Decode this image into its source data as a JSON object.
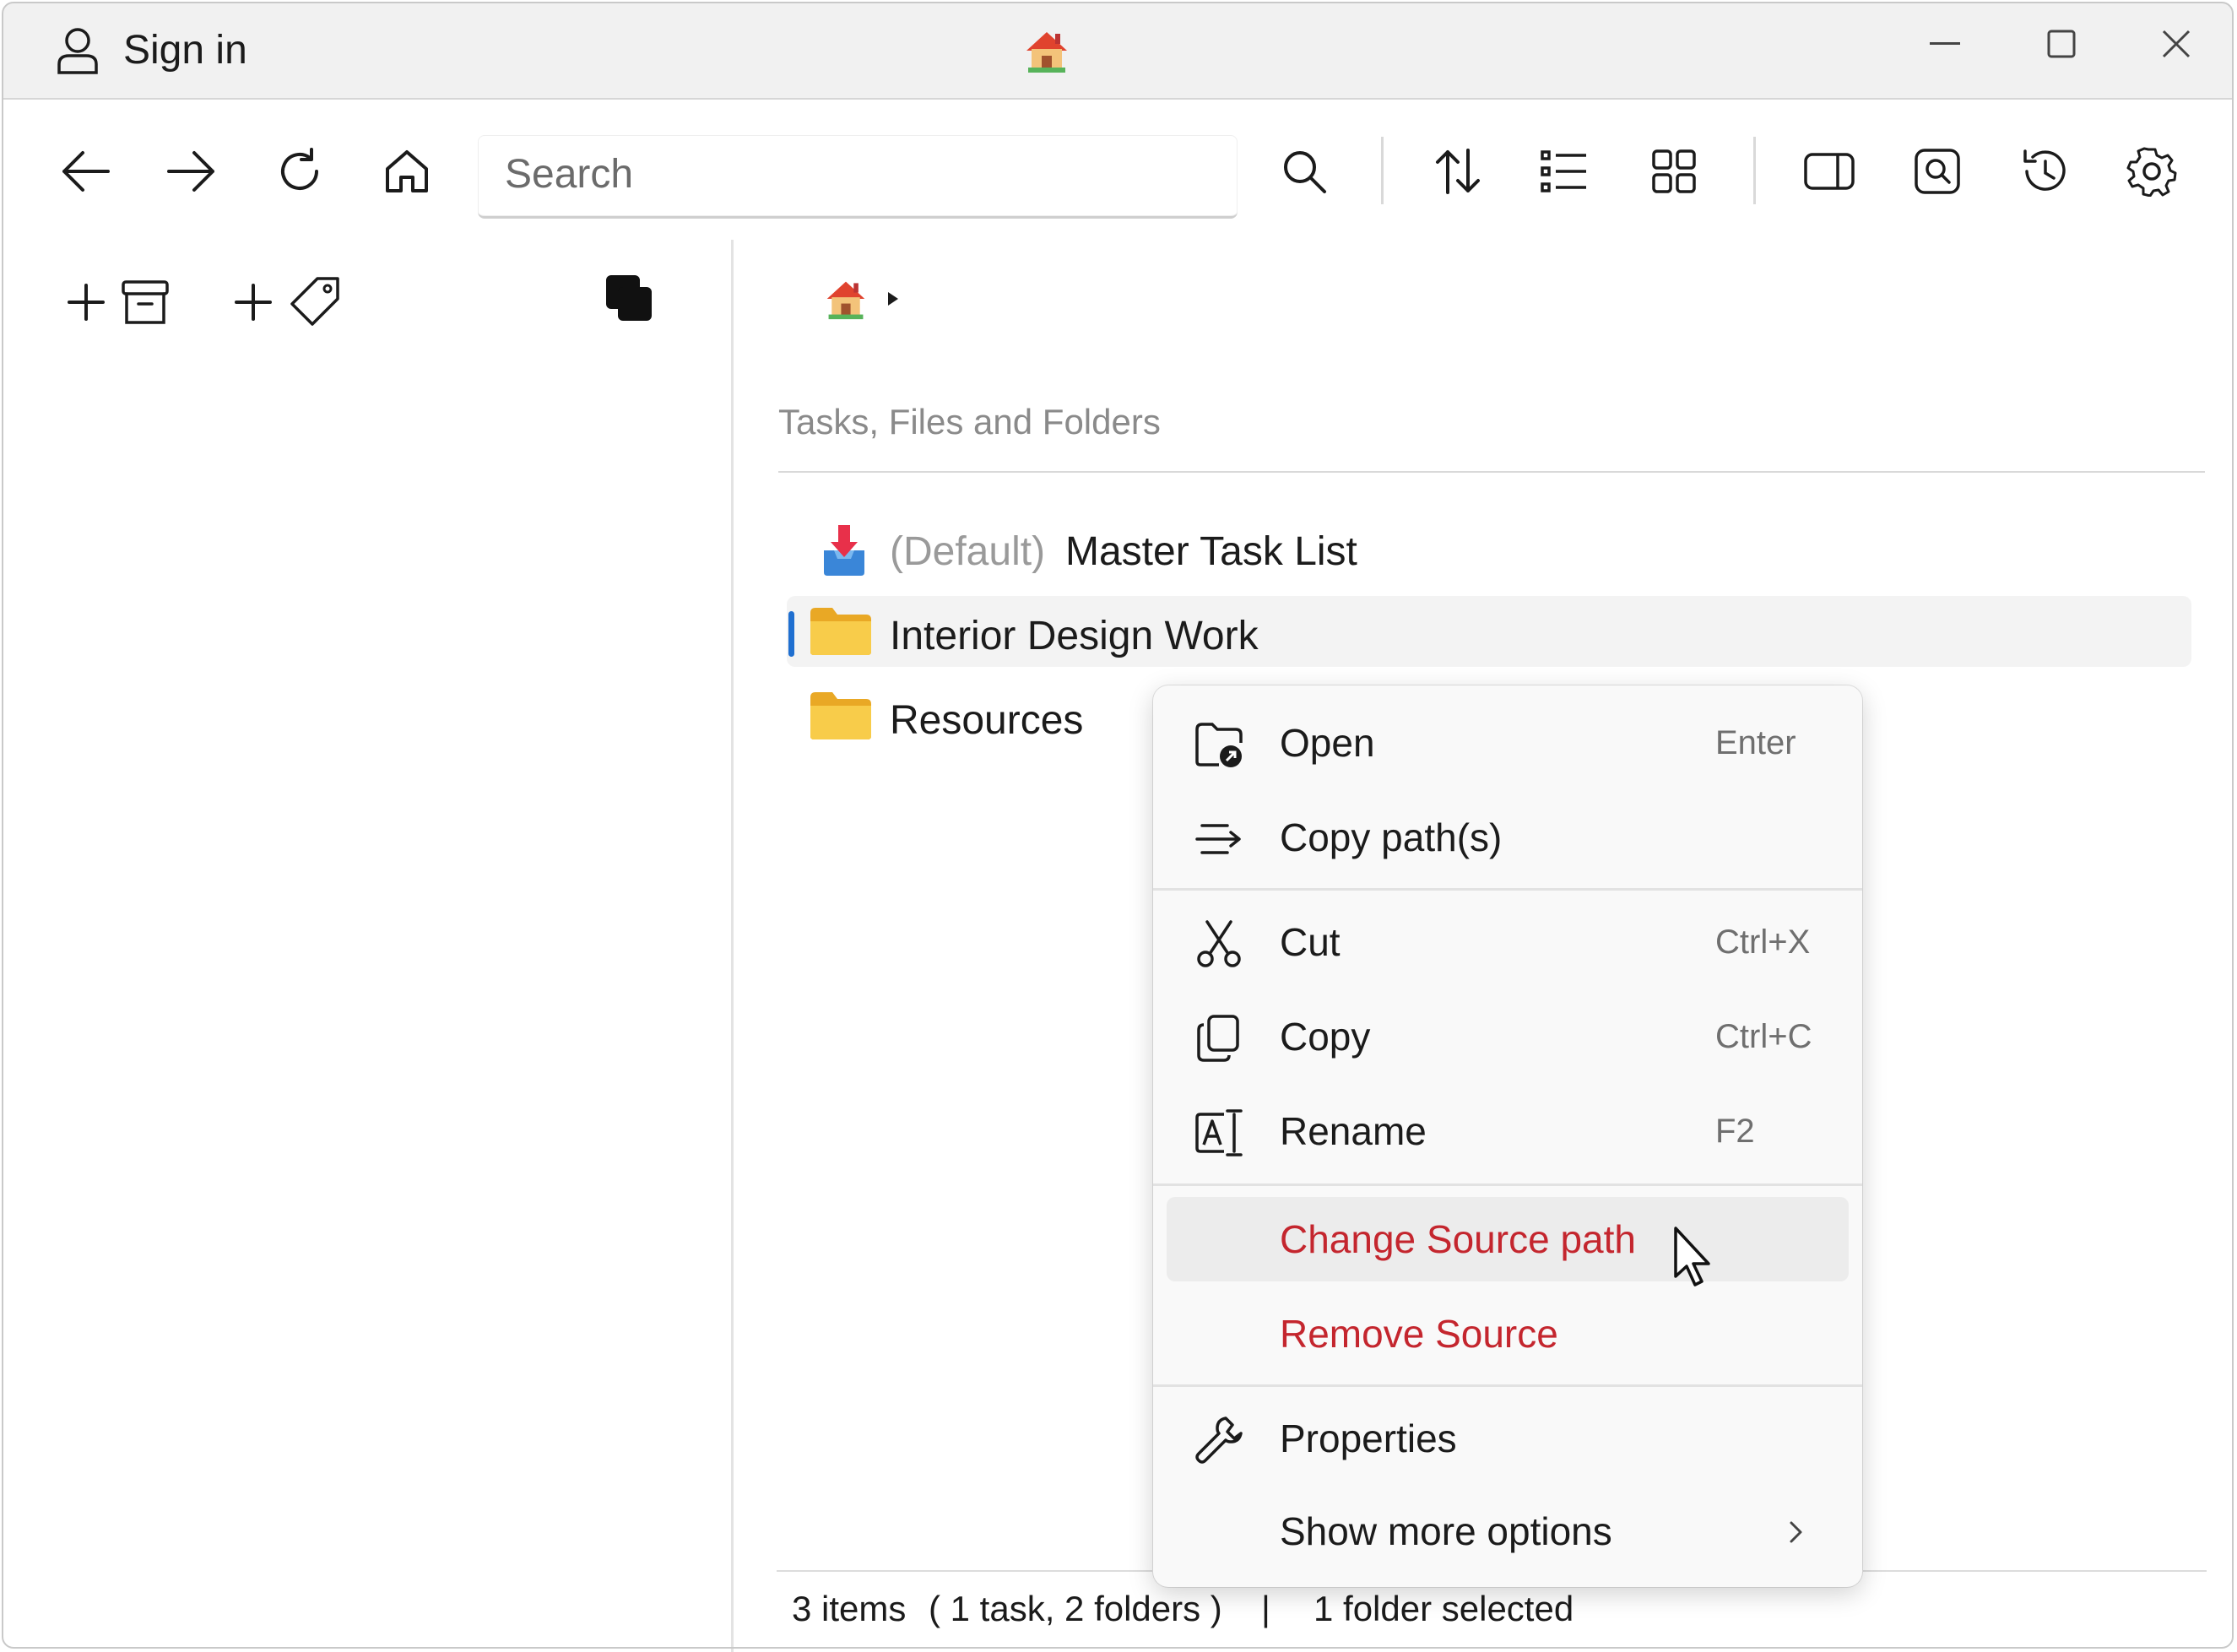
{
  "titlebar": {
    "sign_in_label": "Sign in",
    "app_icon": "house-emoji-icon",
    "controls": [
      "minimize-icon",
      "maximize-icon",
      "close-icon"
    ]
  },
  "toolbar": {
    "search_placeholder": "Search",
    "icons": [
      "back-arrow-icon",
      "forward-arrow-icon",
      "refresh-icon",
      "home-icon",
      "search-icon",
      "sort-icon",
      "list-view-icon",
      "grid-view-icon",
      "preview-pane-icon",
      "search-folder-icon",
      "history-icon",
      "settings-icon"
    ]
  },
  "sidebar": {
    "actions": [
      "add-archive-icon",
      "add-tag-icon",
      "copy-stack-icon"
    ]
  },
  "main": {
    "breadcrumb_home": "🏠",
    "section_label": "Tasks, Files and Folders",
    "items": [
      {
        "prefix": "(Default)",
        "label": "Master Task List",
        "icon": "inbox-download-icon"
      },
      {
        "label": "Interior Design Work",
        "icon": "folder-icon",
        "selected": true
      },
      {
        "label": "Resources",
        "icon": "folder-icon"
      }
    ]
  },
  "context_menu": {
    "items": [
      {
        "label": "Open",
        "shortcut": "Enter",
        "icon": "open-folder-icon"
      },
      {
        "label": "Copy path(s)",
        "shortcut": "",
        "icon": "copy-path-icon"
      },
      {
        "label": "Cut",
        "shortcut": "Ctrl+X",
        "icon": "scissors-icon"
      },
      {
        "label": "Copy",
        "shortcut": "Ctrl+C",
        "icon": "copy-icon"
      },
      {
        "label": "Rename",
        "shortcut": "F2",
        "icon": "rename-icon"
      },
      {
        "label": "Change Source path",
        "shortcut": "",
        "danger": true
      },
      {
        "label": "Remove Source",
        "shortcut": "",
        "danger": true
      },
      {
        "label": "Properties",
        "shortcut": "",
        "icon": "wrench-icon"
      },
      {
        "label": "Show more options",
        "shortcut": "",
        "icon": "chevron-right-icon"
      }
    ],
    "danger_color": "#c4262e"
  },
  "status_bar": {
    "items_count": "3 items",
    "breakdown": "( 1 task, 2 folders )",
    "separator": "|",
    "selection": "1 folder selected"
  },
  "colors": {
    "accent": "#1f6fd0",
    "folder": "#f7c948",
    "danger": "#c4262e"
  }
}
